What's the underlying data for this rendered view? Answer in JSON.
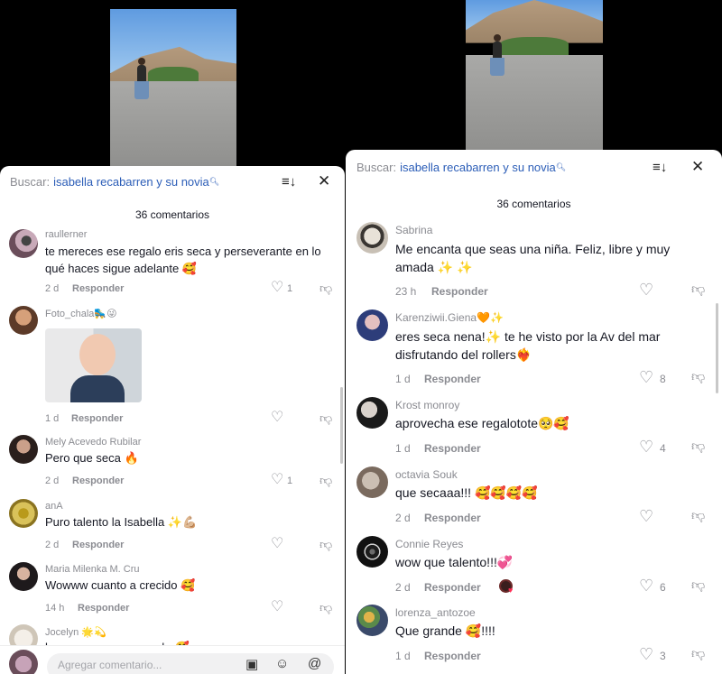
{
  "left": {
    "search_label": "Buscar:",
    "search_query": "isabella recabarren y su novia",
    "count_label": "36 comentarios",
    "add_placeholder": "Agregar comentario...",
    "comments": [
      {
        "user": "raullerner",
        "text": "te mereces ese regalo eris seca y perseverante en lo qué haces sigue adelante 🥰",
        "time": "2 d",
        "reply": "Responder",
        "likes": "1"
      },
      {
        "user": "Foto_chala🛼😜",
        "text": "",
        "time": "1 d",
        "reply": "Responder",
        "likes": ""
      },
      {
        "user": "Mely Acevedo Rubilar",
        "text": "Pero que seca 🔥",
        "time": "2 d",
        "reply": "Responder",
        "likes": "1"
      },
      {
        "user": "anA",
        "text": "Puro talento la Isabella ✨💪🏼",
        "time": "2 d",
        "reply": "Responder",
        "likes": ""
      },
      {
        "user": "Maria Milenka M. Cru",
        "text": "Wowww cuanto a crecido 🥰",
        "time": "14 h",
        "reply": "Responder",
        "likes": ""
      },
      {
        "user": "Jocelyn 🌟💫",
        "text": "hermosa como su madre🥰",
        "time": "",
        "reply": "",
        "likes": ""
      }
    ]
  },
  "right": {
    "search_label": "Buscar:",
    "search_query": "isabella recabarren y su novia",
    "count_label": "36 comentarios",
    "comments": [
      {
        "user": "Sabrina",
        "text": "Me encanta que seas una niña. Feliz, libre y muy amada ✨ ✨",
        "time": "23 h",
        "reply": "Responder",
        "likes": ""
      },
      {
        "user": "Karenziwii.Giena🧡✨",
        "text": "eres seca nena!✨ te he visto por la Av del mar disfrutando del rollers❤️‍🔥",
        "time": "1 d",
        "reply": "Responder",
        "likes": "8"
      },
      {
        "user": "Krost monroy",
        "text": "aprovecha ese regalotote🥺🥰",
        "time": "1 d",
        "reply": "Responder",
        "likes": "4"
      },
      {
        "user": "octavia Souk",
        "text": "que secaaa!!! 🥰🥰🥰🥰",
        "time": "2 d",
        "reply": "Responder",
        "likes": ""
      },
      {
        "user": "Connie Reyes",
        "text": "wow que talento!!!💞",
        "time": "2 d",
        "reply": "Responder",
        "likes": "6"
      },
      {
        "user": "lorenza_antozoe",
        "text": "Que grande 🥰!!!!",
        "time": "1 d",
        "reply": "Responder",
        "likes": "3"
      }
    ]
  },
  "icons": {
    "sort": "sort-icon",
    "close": "close-icon",
    "heart": "heart-icon",
    "dislike": "dislike-icon",
    "image": "image-icon",
    "emoji": "emoji-icon",
    "mention": "at-icon"
  }
}
